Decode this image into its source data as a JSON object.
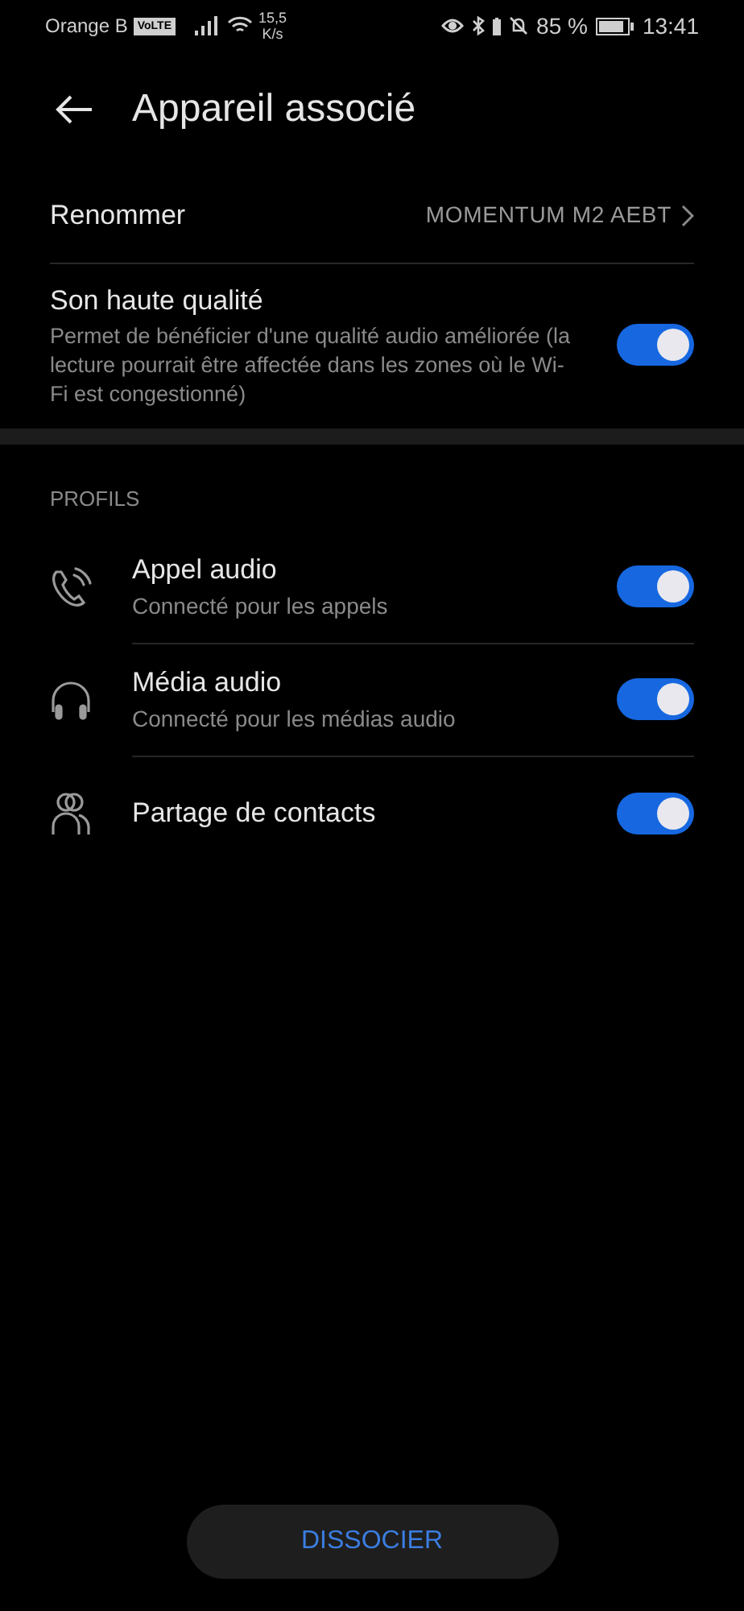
{
  "status_bar": {
    "carrier": "Orange B",
    "volte": "VoLTE",
    "speed_value": "15,5",
    "speed_unit": "K/s",
    "battery": "85 %",
    "time": "13:41"
  },
  "header": {
    "title": "Appareil associé"
  },
  "rename": {
    "label": "Renommer",
    "value": "MOMENTUM M2 AEBT"
  },
  "hq_sound": {
    "title": "Son haute qualité",
    "description": "Permet de bénéficier d'une qualité audio améliorée (la lecture pourrait être affectée dans les zones où le Wi-Fi est congestionné)",
    "on": true
  },
  "profiles": {
    "heading": "PROFILS",
    "items": [
      {
        "title": "Appel audio",
        "subtitle": "Connecté pour les appels",
        "on": true
      },
      {
        "title": "Média audio",
        "subtitle": "Connecté pour les médias audio",
        "on": true
      },
      {
        "title": "Partage de contacts",
        "on": true
      }
    ]
  },
  "unpair_button": "DISSOCIER"
}
